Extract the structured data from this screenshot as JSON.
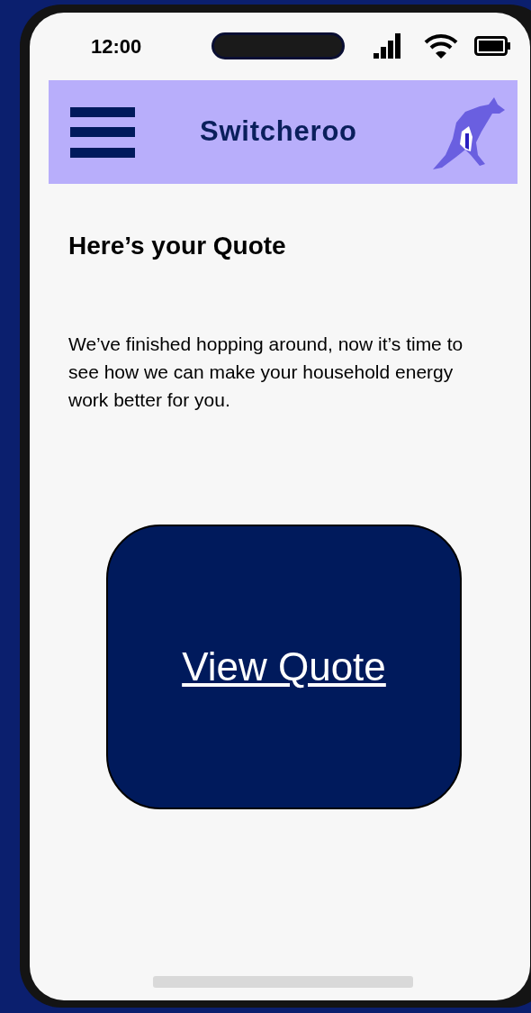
{
  "status_bar": {
    "time": "12:00"
  },
  "header": {
    "title": "Switcheroo"
  },
  "heading": "Here’s your Quote",
  "body": "We’ve finished hopping around, now it’s time to see how we can make your household energy work better for you.",
  "button": {
    "label": "View Quote"
  }
}
